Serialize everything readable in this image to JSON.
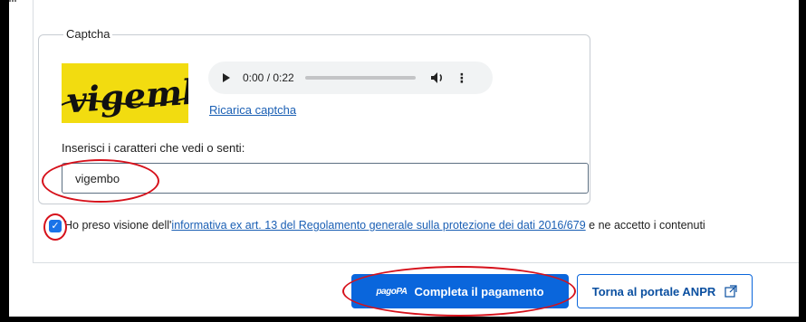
{
  "captcha": {
    "legend": "Captcha",
    "image_text": "vigembo",
    "audio": {
      "time": "0:00 / 0:22",
      "progress": 0.0
    },
    "reload_label": "Ricarica captcha",
    "input_label": "Inserisci i caratteri che vedi o senti:",
    "input_value": "vigembo"
  },
  "consent": {
    "checked": true,
    "prefix": "Ho preso visione dell'",
    "link": "informativa ex art. 13 del Regolamento generale sulla protezione dei dati 2016/679",
    "suffix": " e ne accetto i contenuti"
  },
  "actions": {
    "pay_logo": "pagoPA",
    "pay_label": "Completa il pagamento",
    "back_label": "Torna al portale ANPR"
  },
  "colors": {
    "primary": "#0a66dc",
    "annotation": "#d6111b",
    "captcha_bg": "#f2dc10"
  }
}
